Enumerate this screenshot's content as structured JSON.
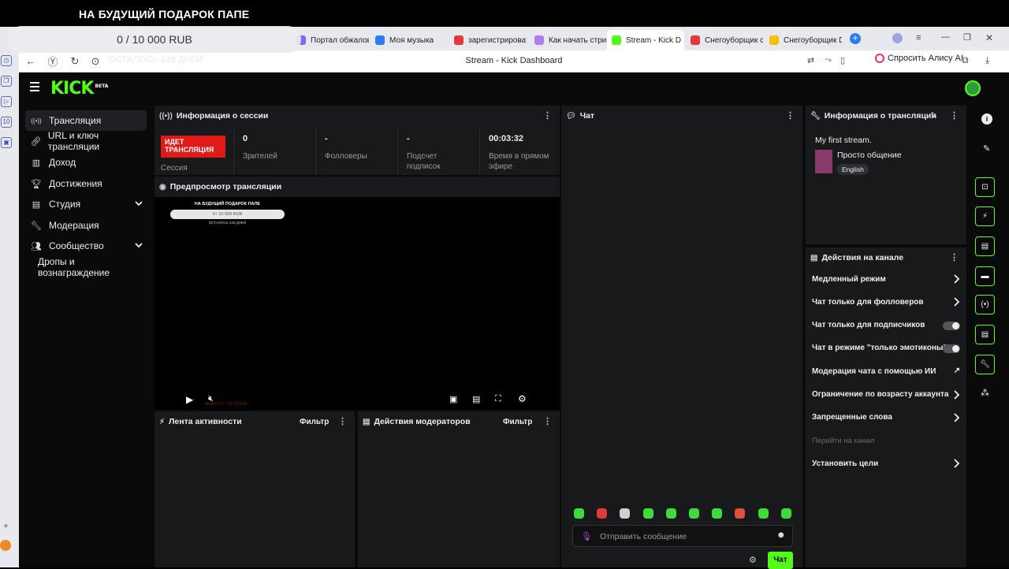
{
  "overlay": {
    "title": "НА БУДУЩИЙ ПОДАРОК ПАПЕ",
    "goal": "0 / 10 000 RUB",
    "remaining": "ОСТАЛОСЬ 248 ДНЕЙ"
  },
  "browser": {
    "tabs": [
      {
        "label": "Портал обжалов",
        "color": "#7c6cf0"
      },
      {
        "label": "Моя музыка",
        "color": "#2d7bf3"
      },
      {
        "label": "зарегистрироват",
        "color": "#e23a3a"
      },
      {
        "label": "Как начать стрим",
        "color": "#b07cf2"
      },
      {
        "label": "Stream - Kick D",
        "color": "#53fc18",
        "active": true
      },
      {
        "label": "Снегоуборщик с",
        "color": "#e23a3a"
      },
      {
        "label": "Снегоуборщик D",
        "color": "#f2c200"
      }
    ],
    "page_title": "Stream - Kick Dashboard",
    "alisa_label": "Спросить Алису AI"
  },
  "sidebar": {
    "items": [
      {
        "label": "Трансляция",
        "icon": "broadcast-icon",
        "active": true
      },
      {
        "label": "URL и ключ трансляции",
        "icon": "key-icon"
      },
      {
        "label": "Доход",
        "icon": "chart-icon"
      },
      {
        "label": "Достижения",
        "icon": "trophy-icon"
      },
      {
        "label": "Студия",
        "icon": "studio-icon",
        "chevron": true
      },
      {
        "label": "Модерация",
        "icon": "wrench-icon"
      },
      {
        "label": "Сообщество",
        "icon": "community-icon",
        "chevron": true
      },
      {
        "label": "Дропы и вознаграждение",
        "icon": ""
      }
    ]
  },
  "session": {
    "title": "Информация о сессии",
    "live_badge": "ИДЕТ ТРАНСЛЯЦИЯ",
    "session_label": "Сессия",
    "stats": [
      {
        "value": "0",
        "label": "Зрителей"
      },
      {
        "value": "-",
        "label": "Фолловеры"
      },
      {
        "value": "-",
        "label": "Подсчет подписок"
      },
      {
        "value": "00:03:32",
        "label": "Время в прямом эфире"
      }
    ]
  },
  "preview": {
    "title": "Предпросмотр трансляции",
    "mini_title": "НА БУДУЩИЙ ПОДАРОК ПАПЕ",
    "mini_goal": "0 / 10 000 RUB",
    "mini_remaining": "ОСТАЛОСЬ 248 ДНЕЙ",
    "bottom_note": "Alinkat 777 - 76,79 RUB"
  },
  "activity": {
    "title": "Лента активности",
    "filter": "Фильтр"
  },
  "modactions": {
    "title": "Действия модераторов",
    "filter": "Фильтр"
  },
  "chat": {
    "title": "Чат",
    "placeholder": "Отправить сообщение",
    "send": "Чат"
  },
  "stream_info": {
    "title": "Информация о трансляции",
    "stream_title": "My first stream.",
    "category": "Просто общение",
    "language": "English"
  },
  "channel_actions": {
    "title": "Действия на канале",
    "items": [
      {
        "label": "Медленный режим",
        "control": "chevron"
      },
      {
        "label": "Чат только для фолловеров",
        "control": "chevron"
      },
      {
        "label": "Чат только для подписчиков",
        "control": "toggle"
      },
      {
        "label": "Чат в режиме \"только эмотиконы\"",
        "control": "toggle"
      },
      {
        "label": "Модерация чата с помощью ИИ",
        "control": "external"
      },
      {
        "label": "Ограничение по возрасту аккаунта",
        "control": "chevron"
      },
      {
        "label": "Запрещенные слова",
        "control": "chevron"
      },
      {
        "label": "Перейти на канал",
        "control": "none",
        "disabled": true
      },
      {
        "label": "Установить цели",
        "control": "chevron"
      }
    ]
  },
  "colors": {
    "accent": "#53fc18",
    "live": "#e01919",
    "panel": "#18191b"
  }
}
